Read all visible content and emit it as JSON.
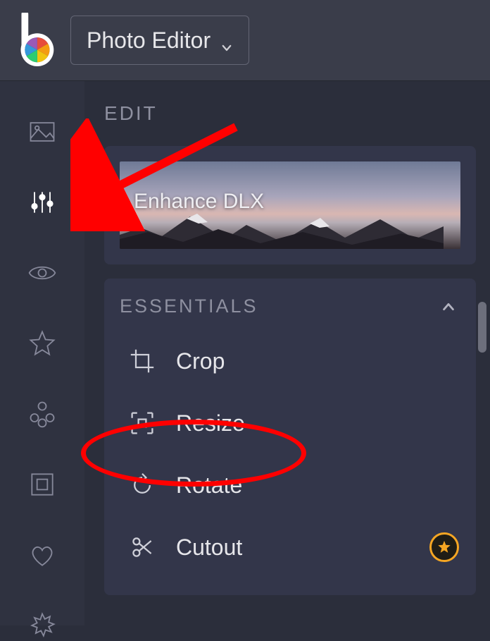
{
  "header": {
    "dropdown_label": "Photo Editor"
  },
  "panel": {
    "edit_title": "EDIT",
    "enhance_label": "Enhance DLX",
    "essentials_title": "ESSENTIALS",
    "tools": {
      "crop": "Crop",
      "resize": "Resize",
      "rotate": "Rotate",
      "cutout": "Cutout"
    }
  },
  "rail": {
    "icons": [
      "image",
      "sliders",
      "eye",
      "star",
      "shapes",
      "frame",
      "heart",
      "burst"
    ]
  }
}
